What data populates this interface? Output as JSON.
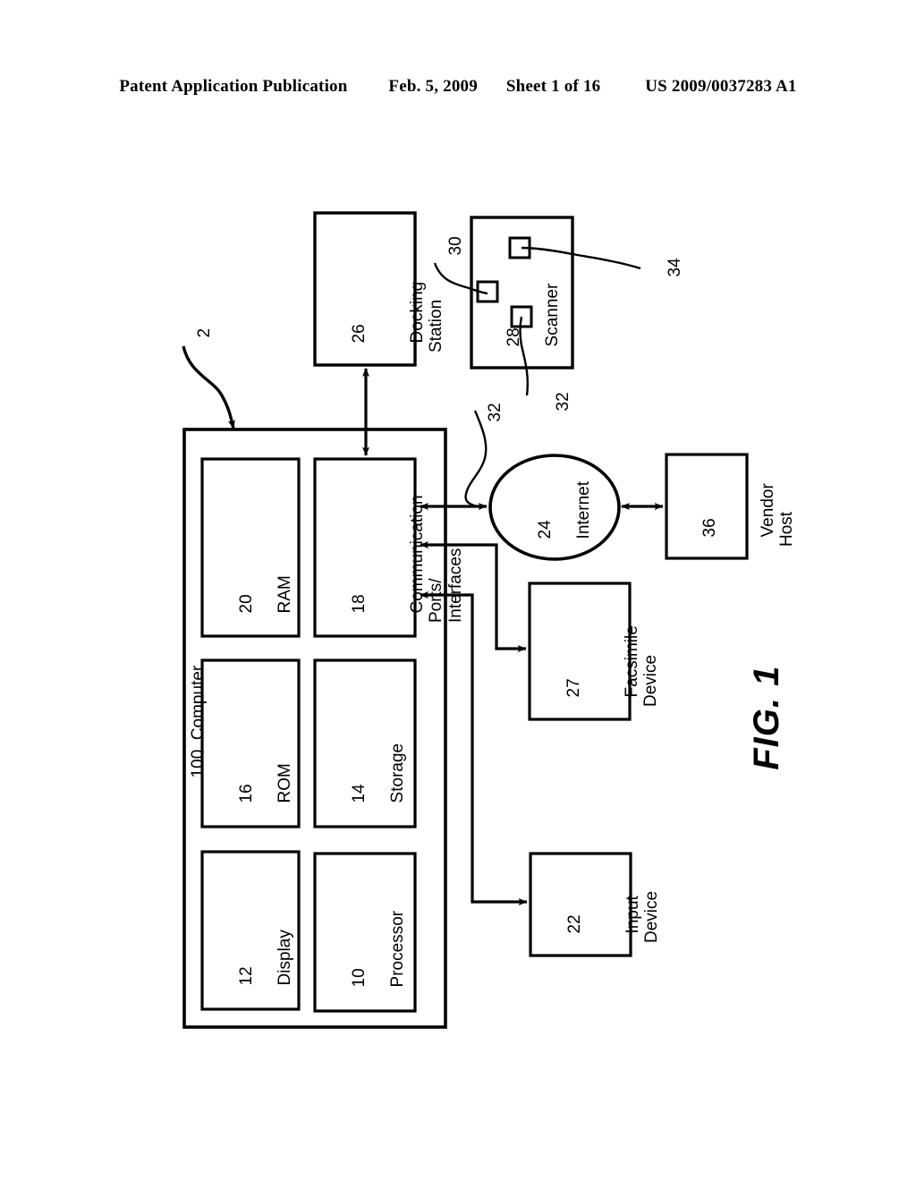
{
  "header": {
    "publication": "Patent Application Publication",
    "date": "Feb. 5, 2009",
    "sheet": "Sheet 1 of 16",
    "patent_number": "US 2009/0037283 A1"
  },
  "figure": {
    "label": "FIG. 1",
    "system_ref": "2",
    "computer": {
      "ref": "100",
      "title": "Computer",
      "label_text": "100  Computer",
      "blocks": [
        {
          "ref": "12",
          "title": "Display"
        },
        {
          "ref": "10",
          "title": "Processor"
        },
        {
          "ref": "16",
          "title": "ROM"
        },
        {
          "ref": "14",
          "title": "Storage"
        },
        {
          "ref": "20",
          "title": "RAM"
        },
        {
          "ref": "18",
          "title": "Communication\nPorts/\nInterfaces"
        }
      ]
    },
    "external_nodes": [
      {
        "ref": "26",
        "title": "Docking\nStation",
        "shape": "rect"
      },
      {
        "ref": "28",
        "title": "Scanner",
        "shape": "rect"
      },
      {
        "ref": "24",
        "title": "Internet",
        "shape": "ellipse"
      },
      {
        "ref": "36",
        "title": "Vendor\nHost",
        "shape": "rect"
      },
      {
        "ref": "27",
        "title": "Facsimile\nDevice",
        "shape": "rect"
      },
      {
        "ref": "22",
        "title": "Input\nDevice",
        "shape": "rect"
      }
    ],
    "leader_refs": [
      {
        "ref": "30",
        "target": "scanner-mark-left"
      },
      {
        "ref": "34",
        "target": "scanner-mark-top"
      },
      {
        "ref": "32",
        "target": "scanner-mark-bottom"
      },
      {
        "ref": "32",
        "target": "internet-link"
      }
    ],
    "colors": {
      "stroke": "#000000",
      "background": "#ffffff"
    }
  }
}
